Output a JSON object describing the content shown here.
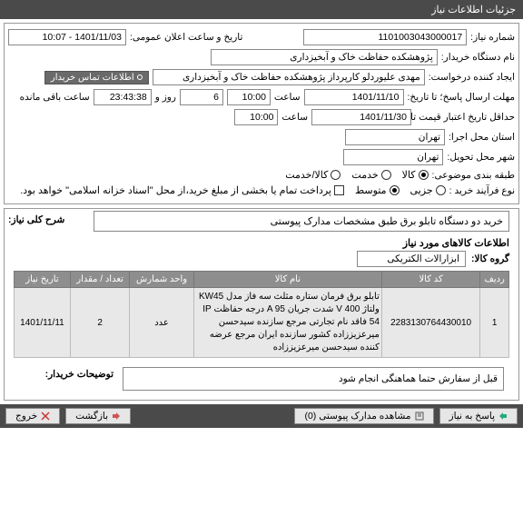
{
  "header": {
    "title": "جزئیات اطلاعات نیاز"
  },
  "fields": {
    "need_no_label": "شماره نیاز:",
    "need_no": "1101003043000017",
    "buyer_label": "نام دستگاه خریدار:",
    "buyer": "پژوهشکده حفاظت خاک و آبخیزداری",
    "creator_label": "ایجاد کننده درخواست:",
    "creator": "مهدی علیوردلو کارپرداز پژوهشکده حفاظت خاک و آبخیزداری",
    "contact_btn": "اطلاعات تماس خریدار",
    "deadline_label": "مهلت ارسال پاسخ؛ تا تاریخ:",
    "deadline_date": "1401/11/10",
    "hour_label": "ساعت",
    "deadline_hour": "10:00",
    "remain_days": "6",
    "day_and_label": "روز و",
    "remain_time": "23:43:38",
    "remain_suffix": "ساعت باقی مانده",
    "validity_label": "حداقل تاریخ اعتبار قیمت تا تاریخ:",
    "validity_date": "1401/11/30",
    "validity_hour": "10:00",
    "announce_label": "تاریخ و ساعت اعلان عمومی:",
    "announce_value": "1401/11/03 - 10:07",
    "exec_addr_label": "استان محل اجرا:",
    "exec_addr": "تهران",
    "deliver_city_label": "شهر محل تحویل:",
    "deliver_city": "تهران",
    "class_label": "طبقه بندی موضوعی:",
    "radio_goods": "کالا",
    "radio_service": "خدمت",
    "radio_goods_service": "کالا/خدمت",
    "process_label": "نوع فرآیند خرید :",
    "radio_small": "جزیی",
    "radio_medium": "متوسط",
    "payment_note_cb": "پرداخت تمام یا بخشی از مبلغ خرید،از محل \"اسناد خزانه اسلامی\" خواهد بود."
  },
  "subject": {
    "label": "شرح کلی نیاز:",
    "text": "خرید دو دستگاه تابلو برق طبق مشخصات مدارک پیوستی"
  },
  "goods_section": {
    "title": "اطلاعات کالاهای مورد نیاز",
    "group_label": "گروه کالا:",
    "group_value": "ابزارالات الکتریکی"
  },
  "table": {
    "headers": {
      "row": "ردیف",
      "code": "کد کالا",
      "name": "نام کالا",
      "unit": "واحد شمارش",
      "qty": "تعداد / مقدار",
      "date": "تاریخ نیاز"
    },
    "rows": [
      {
        "row": "1",
        "code": "2283130764430010",
        "name": "تابلو برق فرمان ستاره مثلث سه فاز مدل KW45 ولتاژ V 400 شدت جریان A 95 درجه حفاظت IP 54 فاقد نام تجارتی مرجع سازنده سیدحسن میرعزیززاده کشور سازنده ایران مرجع عرضه کننده سیدحسن میرعزیززاده",
        "unit": "عدد",
        "qty": "2",
        "date": "1401/11/11"
      }
    ]
  },
  "buyer_note": {
    "label": "توضیحات خریدار:",
    "text": "قبل از سفارش حتما هماهنگی انجام شود"
  },
  "footer": {
    "reply": "پاسخ به نیاز",
    "docs": "مشاهده مدارک پیوستی (0)",
    "back": "بازگشت",
    "exit": "خروج"
  }
}
